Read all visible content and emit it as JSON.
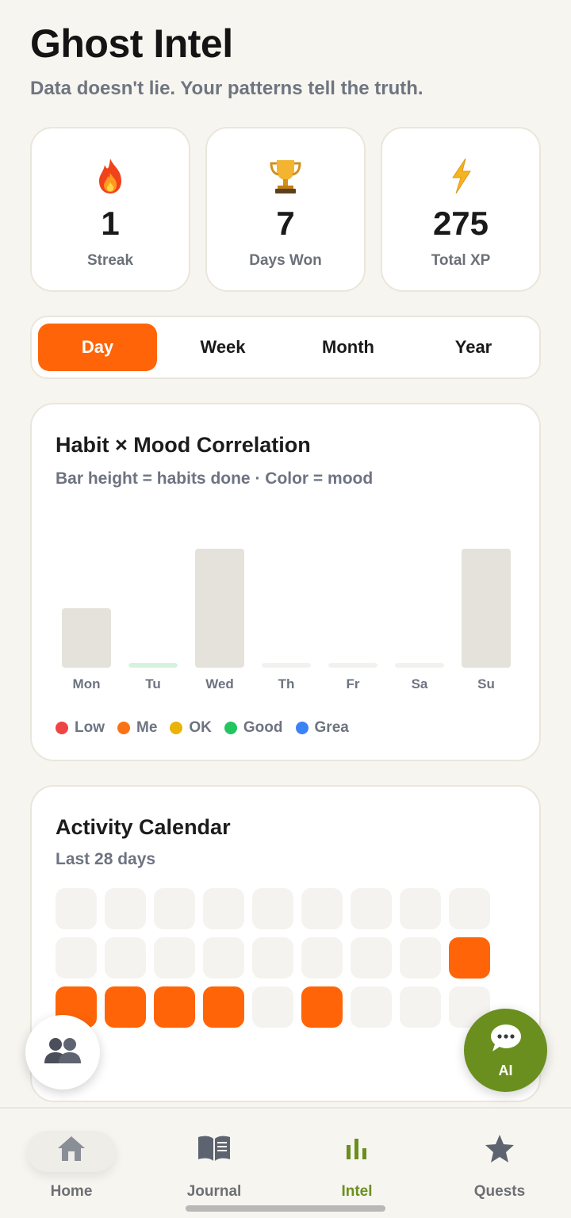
{
  "header": {
    "title": "Ghost Intel",
    "subtitle": "Data doesn't lie. Your patterns tell the truth."
  },
  "stats": [
    {
      "icon": "fire-icon",
      "value": "1",
      "label": "Streak"
    },
    {
      "icon": "trophy-icon",
      "value": "7",
      "label": "Days Won"
    },
    {
      "icon": "lightning-icon",
      "value": "275",
      "label": "Total XP"
    }
  ],
  "tabs": [
    {
      "label": "Day",
      "active": true
    },
    {
      "label": "Week",
      "active": false
    },
    {
      "label": "Month",
      "active": false
    },
    {
      "label": "Year",
      "active": false
    }
  ],
  "correlation": {
    "title": "Habit × Mood Correlation",
    "subtitle": "Bar height = habits done · Color = mood"
  },
  "chart_data": {
    "type": "bar",
    "title": "Habit × Mood Correlation",
    "subtitle": "Bar height = habits done · Color = mood",
    "categories": [
      "Mon",
      "Tu",
      "Wed",
      "Th",
      "Fr",
      "Sa",
      "Su"
    ],
    "values": [
      1,
      0,
      2,
      0,
      0,
      0,
      2
    ],
    "bar_colors": [
      "#e5e2dc",
      "#d6f2df",
      "#e5e2dc",
      "#f3f1ee",
      "#f3f1ee",
      "#f3f1ee",
      "#e5e2dc"
    ],
    "ylim": [
      0,
      2
    ],
    "legend": [
      {
        "label": "Low",
        "color": "#ef4444"
      },
      {
        "label": "Me",
        "color": "#f97316"
      },
      {
        "label": "OK",
        "color": "#eab308"
      },
      {
        "label": "Good",
        "color": "#22c55e"
      },
      {
        "label": "Grea",
        "color": "#3b82f6"
      }
    ],
    "legend_position": "bottom"
  },
  "calendar": {
    "title": "Activity Calendar",
    "subtitle": "Last 28 days",
    "active_color": "#ff6508",
    "rows": [
      [
        0,
        0,
        0,
        0,
        0,
        0,
        0,
        0,
        0
      ],
      [
        0,
        0,
        0,
        0,
        0,
        0,
        0,
        0,
        1
      ],
      [
        1,
        1,
        1,
        1,
        0,
        1,
        0,
        0,
        0
      ]
    ]
  },
  "fab": {
    "ai_label": "AI",
    "left_icon": "two-people-icon",
    "ai_icon": "chat-bubble-icon"
  },
  "nav": [
    {
      "label": "Home",
      "icon": "home-icon",
      "active": false
    },
    {
      "label": "Journal",
      "icon": "book-icon",
      "active": false
    },
    {
      "label": "Intel",
      "icon": "bar-chart-icon",
      "active": true
    },
    {
      "label": "Quests",
      "icon": "star-icon",
      "active": false
    }
  ],
  "colors": {
    "accent": "#ff6508",
    "brand_green": "#6a8f1f",
    "background": "#f7f5f0"
  }
}
